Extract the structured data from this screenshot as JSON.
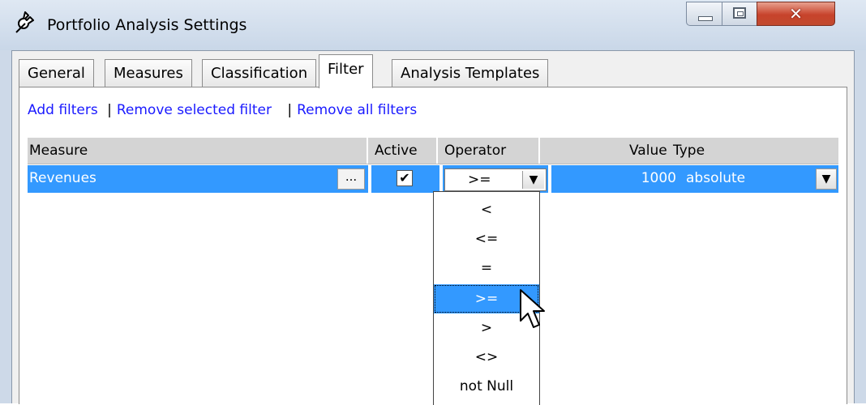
{
  "window": {
    "title": "Portfolio Analysis Settings"
  },
  "tabs": [
    {
      "label": "General"
    },
    {
      "label": "Measures"
    },
    {
      "label": "Classification"
    },
    {
      "label": "Filter",
      "active": true
    },
    {
      "label": "Analysis Templates"
    }
  ],
  "links": {
    "add": "Add filters",
    "remove_selected": "Remove selected filter",
    "remove_all": "Remove all filters",
    "separator": "|"
  },
  "grid": {
    "headers": {
      "measure": "Measure",
      "active": "Active",
      "operator": "Operator",
      "value": "Value",
      "type": "Type"
    },
    "rows": [
      {
        "measure": "Revenues",
        "ellipsis": "...",
        "active": true,
        "active_glyph": "✔",
        "operator": ">=",
        "value": "1000",
        "type": "absolute"
      }
    ]
  },
  "operator_dropdown": {
    "options": [
      "<",
      "<=",
      "=",
      ">=",
      ">",
      "<>",
      "not Null"
    ],
    "selected": ">="
  },
  "icons": {
    "title": "wrench-icon",
    "minimize": "minimize-icon",
    "maximize": "maximize-icon",
    "close": "close-icon",
    "dropdown_arrow": "chevron-down-icon",
    "cursor": "mouse-pointer-icon"
  },
  "colors": {
    "selection": "#3399ff",
    "link": "#1a1aff",
    "close_button": "#c7432b"
  }
}
